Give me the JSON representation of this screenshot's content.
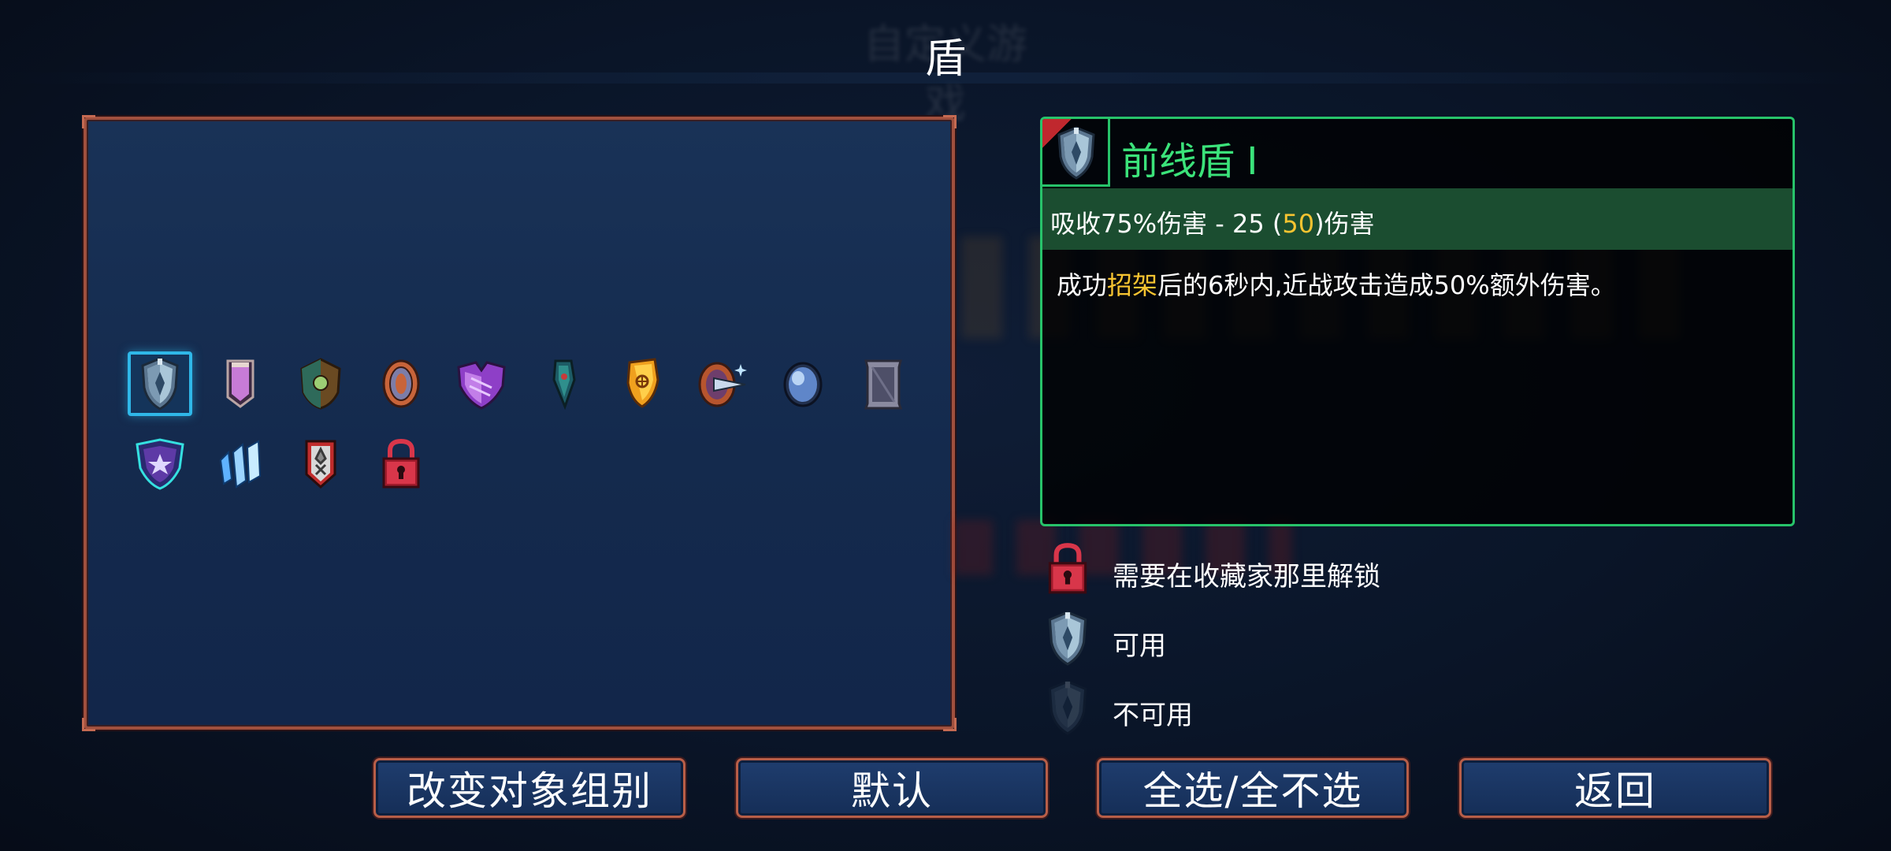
{
  "header": {
    "background_title": "自定义游戏",
    "title": "盾"
  },
  "item_grid": {
    "selected_index": 0,
    "items": [
      {
        "icon": "frontline-shield-icon",
        "state": "available"
      },
      {
        "icon": "purple-banner-shield-icon",
        "state": "available"
      },
      {
        "icon": "green-gem-shield-icon",
        "state": "available"
      },
      {
        "icon": "bronze-round-shield-icon",
        "state": "available"
      },
      {
        "icon": "purple-heart-shield-icon",
        "state": "available"
      },
      {
        "icon": "teal-kite-shield-icon",
        "state": "available"
      },
      {
        "icon": "golden-shield-icon",
        "state": "available"
      },
      {
        "icon": "spike-round-shield-icon",
        "state": "available"
      },
      {
        "icon": "blue-orb-shield-icon",
        "state": "available"
      },
      {
        "icon": "tower-shield-icon",
        "state": "available"
      },
      {
        "icon": "purple-star-shield-icon",
        "state": "available"
      },
      {
        "icon": "ice-crystal-shield-icon",
        "state": "available"
      },
      {
        "icon": "red-white-shield-icon",
        "state": "available"
      },
      {
        "icon": "padlock-icon",
        "state": "locked"
      }
    ]
  },
  "info_panel": {
    "name": "前线盾 I",
    "stat": {
      "prefix": "吸收75%伤害 - 25 (",
      "highlight": "50",
      "suffix": ")伤害"
    },
    "description": {
      "prefix": "成功",
      "highlight": "招架",
      "suffix": "后的6秒内,近战攻击造成50%额外伤害。"
    }
  },
  "legend": [
    {
      "icon": "padlock-icon",
      "label": "需要在收藏家那里解锁"
    },
    {
      "icon": "shield-available-icon",
      "label": "可用"
    },
    {
      "icon": "shield-unavailable-icon",
      "label": "不可用"
    }
  ],
  "buttons": {
    "change_group": "改变对象组别",
    "default": "默认",
    "select_all": "全选/全不选",
    "back": "返回"
  },
  "colors": {
    "panel_border": "#a0503e",
    "selection": "#2fb7e8",
    "info_border": "#27c36a",
    "item_name": "#3be37a",
    "highlight": "#f7c431",
    "stat_bg": "#1b4d30"
  }
}
